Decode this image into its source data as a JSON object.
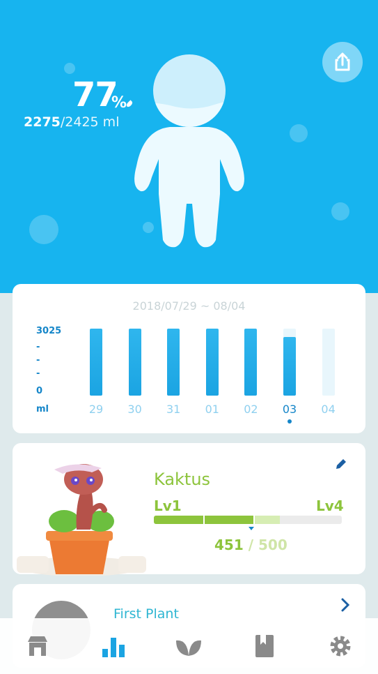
{
  "hero": {
    "percent": "77",
    "percent_unit": "%",
    "current_ml": "2275",
    "goal_ml": "/2425 ml",
    "share_icon": "share-icon"
  },
  "stats": {
    "date_range": "2018/07/29 ~ 08/04",
    "y_axis": {
      "max": "3025",
      "ticks": [
        "-",
        "-",
        "-"
      ],
      "min": "0",
      "unit": "ml"
    },
    "selected_day": "03"
  },
  "chart_data": {
    "type": "bar",
    "categories": [
      "29",
      "30",
      "31",
      "01",
      "02",
      "03",
      "04"
    ],
    "values": [
      3025,
      3025,
      3025,
      3025,
      3025,
      2640,
      0
    ],
    "ylabel": "ml",
    "ylim": [
      0,
      3025
    ],
    "title": "2018/07/29 ~ 08/04"
  },
  "plant": {
    "name": "Kaktus",
    "level_current": "Lv1",
    "level_max": "Lv4",
    "xp": "451",
    "xp_sep": " / ",
    "xp_max": "500",
    "progress": 0.53,
    "edit_icon": "pencil-icon"
  },
  "first_plant": {
    "title": "First Plant"
  },
  "colors": {
    "hero_bg": "#17b4ef",
    "bar": "#1ba4e2",
    "plant_green": "#8dc43c",
    "selected": "#1586c9"
  },
  "tabs": [
    {
      "icon": "shop-icon"
    },
    {
      "icon": "stats-icon",
      "active": true
    },
    {
      "icon": "leaf-icon"
    },
    {
      "icon": "book-icon"
    },
    {
      "icon": "gear-icon"
    }
  ]
}
